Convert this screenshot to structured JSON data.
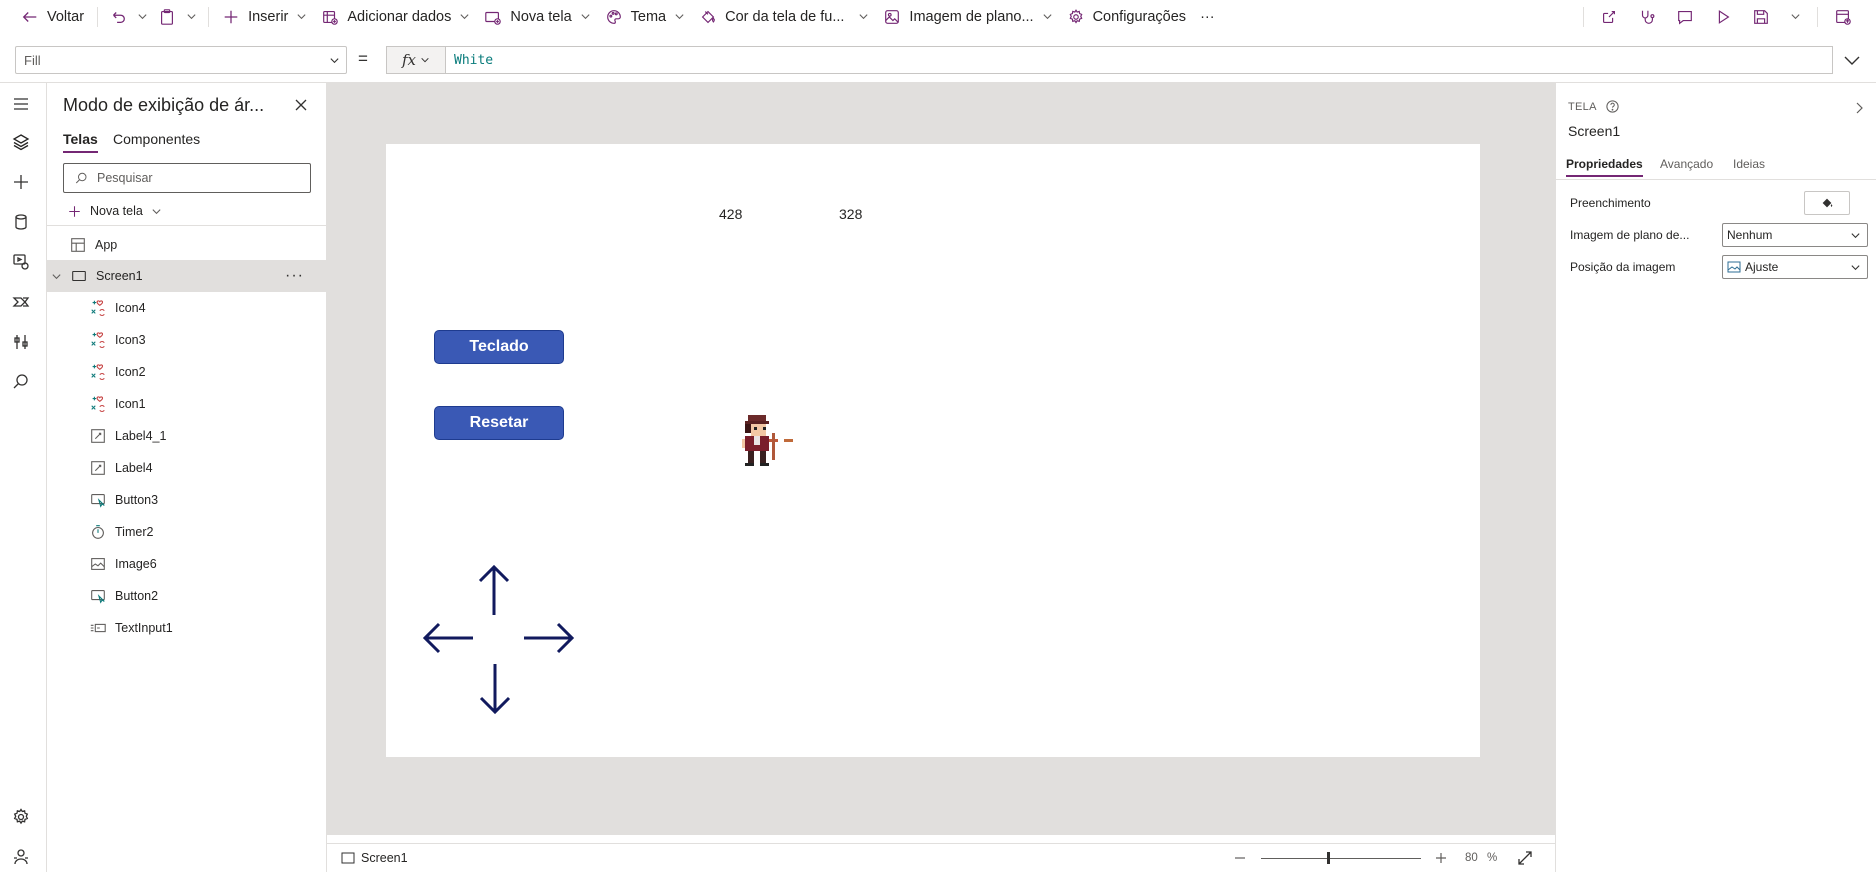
{
  "toolbar": {
    "back": "Voltar",
    "insert": "Inserir",
    "add_data": "Adicionar dados",
    "new_screen": "Nova tela",
    "theme": "Tema",
    "bg_color": "Cor da tela de fu...",
    "bg_image": "Imagem de plano...",
    "settings": "Configurações",
    "more": "···"
  },
  "formula": {
    "property": "Fill",
    "equals": "=",
    "fx": "fx",
    "value": "White"
  },
  "tree": {
    "title": "Modo de exibição de ár...",
    "tab_screens": "Telas",
    "tab_components": "Componentes",
    "search_placeholder": "Pesquisar",
    "new_screen": "Nova tela",
    "app": "App",
    "screen": "Screen1",
    "more": "···",
    "children": [
      {
        "label": "Icon4",
        "icon": "icons-icon"
      },
      {
        "label": "Icon3",
        "icon": "icons-icon"
      },
      {
        "label": "Icon2",
        "icon": "icons-icon"
      },
      {
        "label": "Icon1",
        "icon": "icons-icon"
      },
      {
        "label": "Label4_1",
        "icon": "label-icon"
      },
      {
        "label": "Label4",
        "icon": "label-icon"
      },
      {
        "label": "Button3",
        "icon": "button-icon"
      },
      {
        "label": "Timer2",
        "icon": "timer-icon"
      },
      {
        "label": "Image6",
        "icon": "image-icon"
      },
      {
        "label": "Button2",
        "icon": "button-icon"
      },
      {
        "label": "TextInput1",
        "icon": "text-input-icon"
      }
    ]
  },
  "canvas": {
    "label_x": "428",
    "label_y": "328",
    "button_keyboard": "Teclado",
    "button_reset": "Resetar",
    "button_color": "#3a59b5",
    "arrow_color": "#111a5e"
  },
  "status": {
    "screen": "Screen1",
    "zoom_value": "80",
    "zoom_unit": "%",
    "zoom_level": 0.8
  },
  "props": {
    "kind": "TELA",
    "name": "Screen1",
    "tab_properties": "Propriedades",
    "tab_advanced": "Avançado",
    "tab_ideas": "Ideias",
    "fill_label": "Preenchimento",
    "bg_image_label": "Imagem de plano de...",
    "bg_image_value": "Nenhum",
    "image_position_label": "Posição da imagem",
    "image_position_value": "Ajuste"
  },
  "colors": {
    "accent": "#742774",
    "canvas_bg": "#e1dfdd"
  }
}
